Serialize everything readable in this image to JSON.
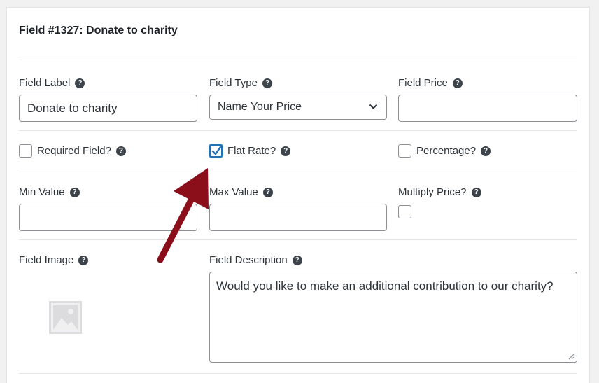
{
  "field": {
    "title": "Field #1327: Donate to charity"
  },
  "labels": {
    "field_label": "Field Label",
    "field_type": "Field Type",
    "field_price": "Field Price",
    "min_value": "Min Value",
    "max_value": "Max Value",
    "multiply_price": "Multiply Price?",
    "field_image": "Field Image",
    "field_description": "Field Description"
  },
  "inputs": {
    "field_label_value": "Donate to charity",
    "field_type_selected": "Name Your Price",
    "field_price_value": "",
    "min_value_value": "",
    "max_value_value": ""
  },
  "checkboxes": {
    "required_field": {
      "label": "Required Field?",
      "checked": false
    },
    "flat_rate": {
      "label": "Flat Rate?",
      "checked": true
    },
    "percentage": {
      "label": "Percentage?",
      "checked": false
    },
    "multiply_price": {
      "checked": false
    }
  },
  "description": {
    "text": "Would you like to make an additional contribution to our charity?"
  },
  "help_glyph": "?",
  "colors": {
    "accent": "#2271b1",
    "arrow": "#8b0f1a",
    "border": "#8c8f94"
  },
  "icons": {
    "help": "question-circle-icon",
    "select": "chevron-down-icon",
    "image": "image-placeholder-icon",
    "annotation": "arrow-annotation"
  }
}
